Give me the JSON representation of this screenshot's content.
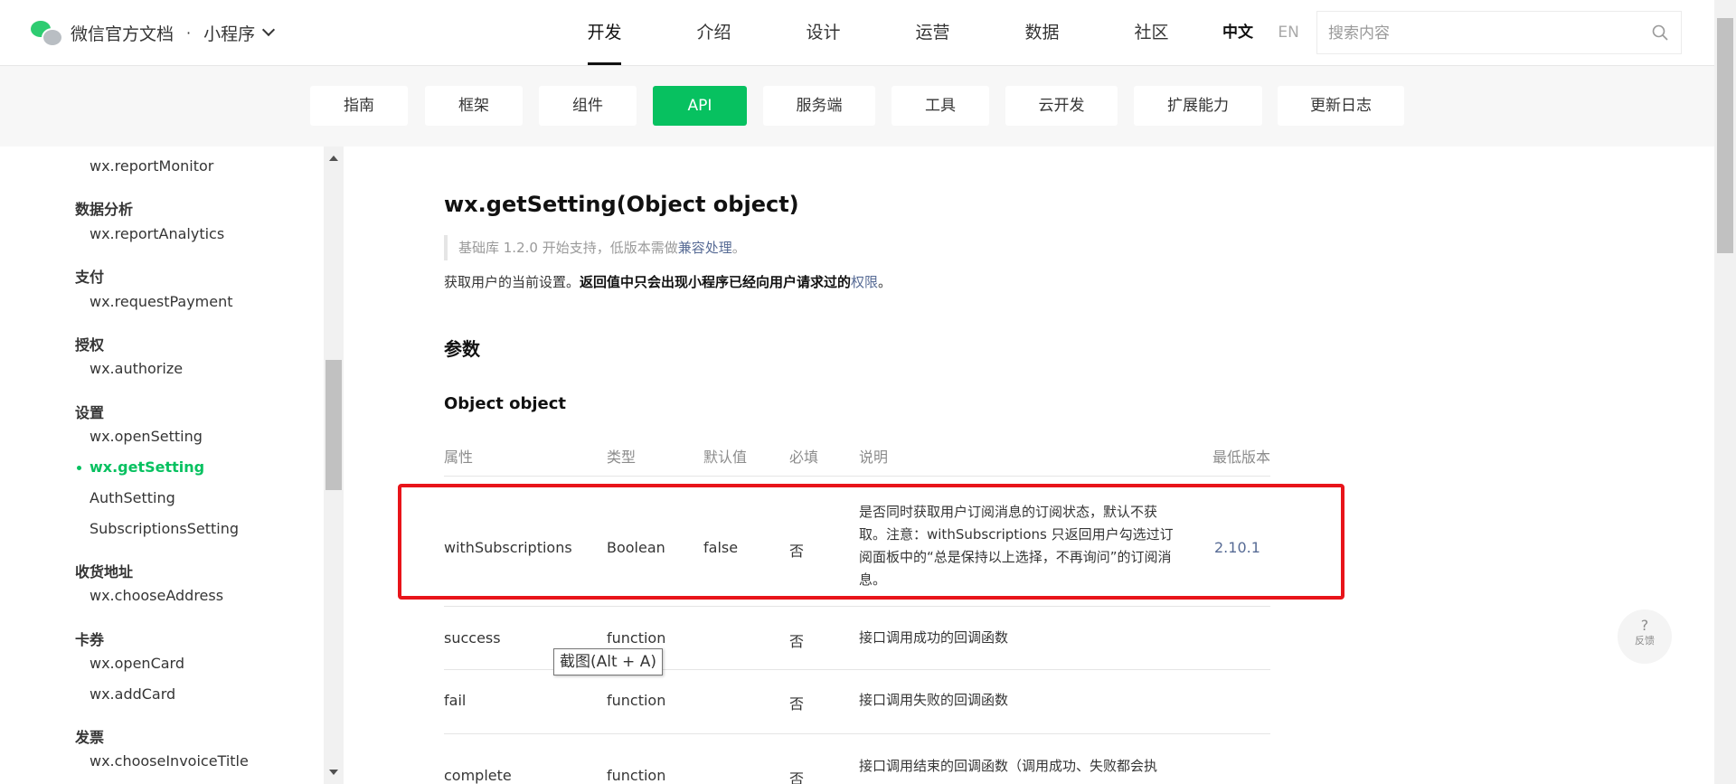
{
  "header": {
    "brand_title": "微信官方文档",
    "brand_separator": "·",
    "brand_product": "小程序",
    "nav": [
      "开发",
      "介绍",
      "设计",
      "运营",
      "数据",
      "社区"
    ],
    "active_nav": "开发",
    "lang_zh": "中文",
    "lang_en": "EN",
    "search_placeholder": "搜索内容"
  },
  "subnav": {
    "tabs": [
      "指南",
      "框架",
      "组件",
      "API",
      "服务端",
      "工具",
      "云开发",
      "扩展能力",
      "更新日志"
    ],
    "active": "API"
  },
  "sidebar": {
    "items": [
      {
        "type": "item",
        "label": "wx.reportMonitor"
      },
      {
        "type": "head",
        "label": "数据分析"
      },
      {
        "type": "item",
        "label": "wx.reportAnalytics"
      },
      {
        "type": "head",
        "label": "支付"
      },
      {
        "type": "item",
        "label": "wx.requestPayment"
      },
      {
        "type": "head",
        "label": "授权"
      },
      {
        "type": "item",
        "label": "wx.authorize"
      },
      {
        "type": "head",
        "label": "设置"
      },
      {
        "type": "item",
        "label": "wx.openSetting"
      },
      {
        "type": "item",
        "label": "wx.getSetting",
        "active": true
      },
      {
        "type": "item",
        "label": "AuthSetting"
      },
      {
        "type": "item",
        "label": "SubscriptionsSetting"
      },
      {
        "type": "head",
        "label": "收货地址"
      },
      {
        "type": "item",
        "label": "wx.chooseAddress"
      },
      {
        "type": "head",
        "label": "卡券"
      },
      {
        "type": "item",
        "label": "wx.openCard"
      },
      {
        "type": "item",
        "label": "wx.addCard"
      },
      {
        "type": "head",
        "label": "发票"
      },
      {
        "type": "item",
        "label": "wx.chooseInvoiceTitle"
      }
    ]
  },
  "doc": {
    "title": "wx.getSetting(Object object)",
    "note_prefix": "基础库 1.2.0 开始支持，低版本需做",
    "note_link": "兼容处理",
    "note_suffix": "。",
    "desc_plain": "获取用户的当前设置。",
    "desc_bold": "返回值中只会出现小程序已经向用户请求过的",
    "desc_link": "权限",
    "desc_end": "。",
    "section_params": "参数",
    "object_heading": "Object object",
    "table_headers": [
      "属性",
      "类型",
      "默认值",
      "必填",
      "说明",
      "最低版本"
    ],
    "rows": [
      {
        "name": "withSubscriptions",
        "type": "Boolean",
        "default": "false",
        "required": "否",
        "desc": "是否同时获取用户订阅消息的订阅状态，默认不获取。注意：withSubscriptions 只返回用户勾选过订阅面板中的“总是保持以上选择，不再询问”的订阅消息。",
        "version": "2.10.1"
      },
      {
        "name": "success",
        "type": "function",
        "default": "",
        "required": "否",
        "desc": "接口调用成功的回调函数",
        "version": ""
      },
      {
        "name": "fail",
        "type": "function",
        "default": "",
        "required": "否",
        "desc": "接口调用失败的回调函数",
        "version": ""
      },
      {
        "name": "complete",
        "type": "function",
        "default": "",
        "required": "否",
        "desc": "接口调用结束的回调函数（调用成功、失败都会执",
        "version": ""
      }
    ]
  },
  "tooltip": "截图(Alt + A)",
  "feedback": {
    "symbol": "?",
    "label": "反馈"
  },
  "colors": {
    "accent": "#07c160",
    "link": "#576b95",
    "highlight_border": "#e8141a"
  }
}
